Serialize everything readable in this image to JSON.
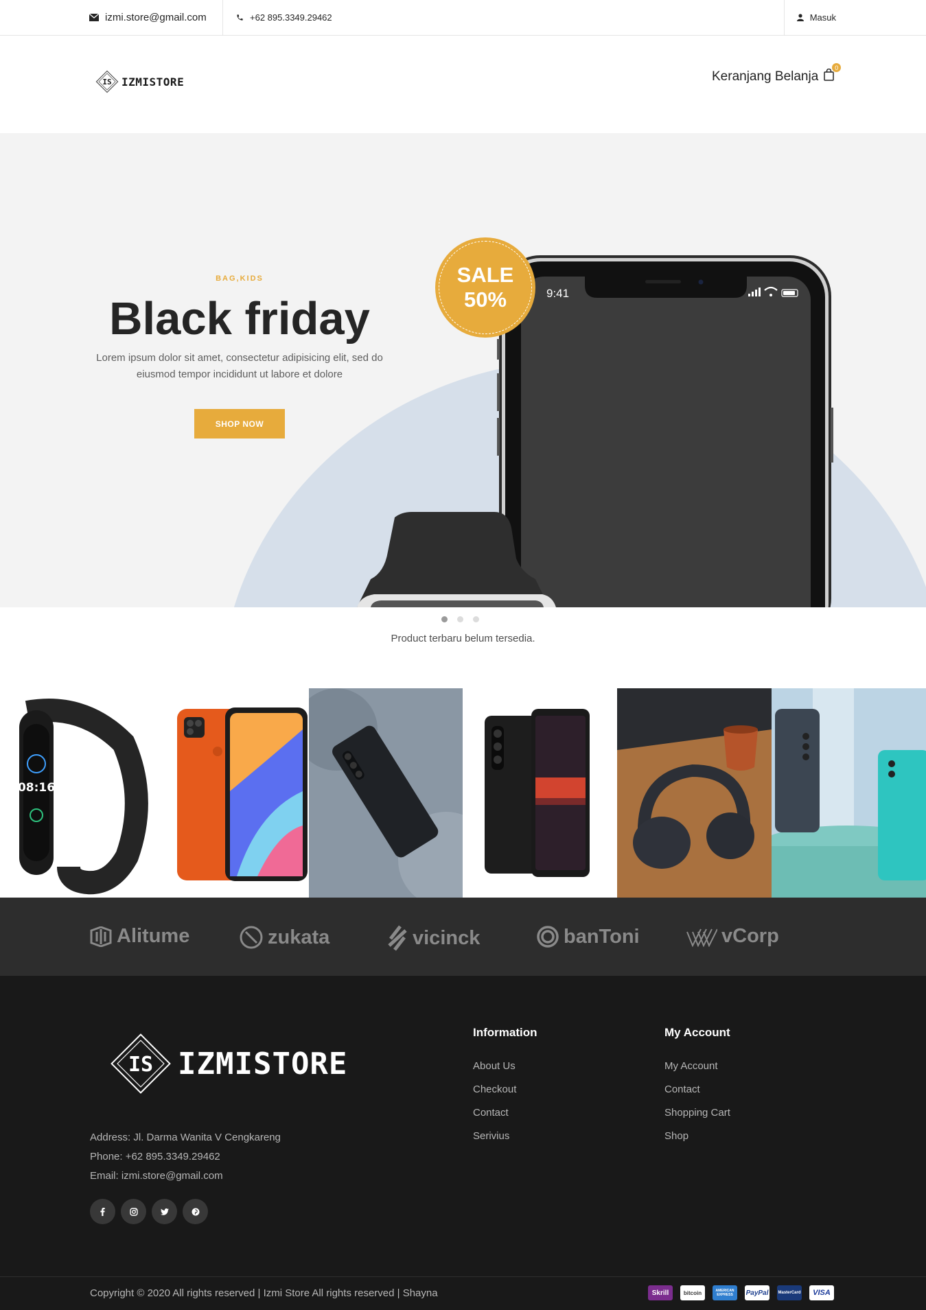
{
  "topbar": {
    "email": "izmi.store@gmail.com",
    "phone": "+62 895.3349.29462",
    "login": "Masuk"
  },
  "header": {
    "logo_mark": "IS",
    "logo_text": "IZMISTORE",
    "cart_label": "Keranjang Belanja",
    "cart_count": "0"
  },
  "hero": {
    "tag": "BAG,KIDS",
    "title": "Black friday",
    "description": "Lorem ipsum dolor sit amet, consectetur adipisicing elit, sed do eiusmod tempor incididunt ut labore et dolore",
    "button": "SHOP NOW",
    "sale_line1": "SALE",
    "sale_line2": "50%",
    "phone_time": "9:41",
    "slides": 3,
    "active_slide": 1
  },
  "products_empty_message": "Product terbaru belum tersedia.",
  "partners": [
    "Alitume",
    "zukata",
    "vicinck",
    "banToni",
    "vCorp"
  ],
  "footer": {
    "logo_mark": "IS",
    "logo_text": "IZMISTORE",
    "address": "Address: Jl. Darma Wanita V Cengkareng",
    "phone": "Phone: +62 895.3349.29462",
    "email": "Email: izmi.store@gmail.com",
    "social_icons": [
      "facebook-icon",
      "instagram-icon",
      "twitter-icon",
      "pinterest-icon"
    ],
    "information": {
      "title": "Information",
      "links": [
        "About Us",
        "Checkout",
        "Contact",
        "Serivius"
      ]
    },
    "account": {
      "title": "My Account",
      "links": [
        "My Account",
        "Contact",
        "Shopping Cart",
        "Shop"
      ]
    },
    "copyright": "Copyright © 2020 All rights reserved | Izmi Store All rights reserved | Shayna",
    "payments": [
      "Skrill",
      "bitcoin",
      "AMERICAN EXPRESS",
      "PayPal",
      "MasterCard",
      "VISA"
    ]
  },
  "colors": {
    "accent": "#e7ab3c",
    "footer_bg": "#191919",
    "partners_bg": "#2d2d2d",
    "hero_bg": "#f3f3f3"
  }
}
